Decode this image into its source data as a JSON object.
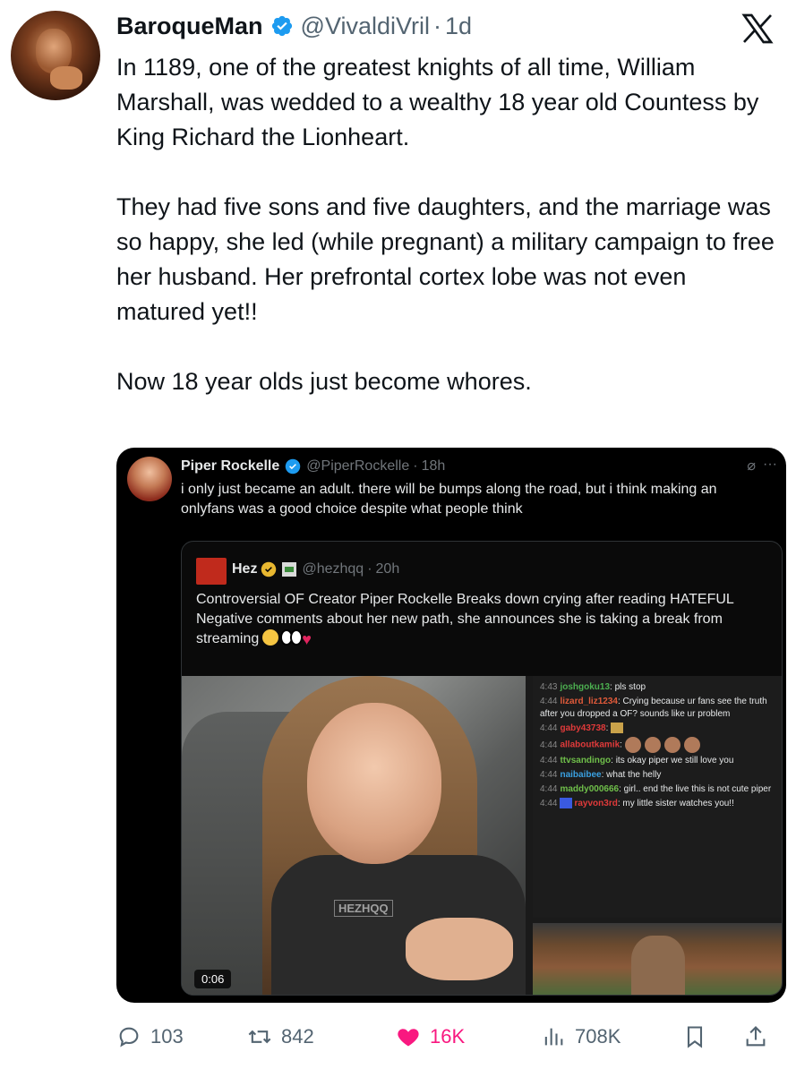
{
  "tweet": {
    "name": "BaroqueMan",
    "handle": "@VivaldiVril",
    "separator": "·",
    "time": "1d",
    "paragraphs": [
      "In 1189, one of the greatest knights of all time, William Marshall, was wedded to a wealthy 18 year old Countess by King Richard the Lionheart.",
      "They had five sons and five daughters, and the marriage was so happy, she led (while pregnant) a military campaign to free her husband. Her prefrontal cortex lobe was not even matured yet!!",
      "Now 18 year olds just become whores."
    ],
    "icons": [
      "verified-badge-icon",
      "x-logo-icon"
    ]
  },
  "quote": {
    "name": "Piper Rockelle",
    "handle": "@PiperRockelle",
    "separator": "·",
    "time": "18h",
    "text": "i only just became an adult. there will be bumps along the road, but i think making an onlyfans was a good choice despite what people think",
    "icons": [
      "edit-icon",
      "more-icon"
    ]
  },
  "inner_quote": {
    "name": "Hez",
    "handle": "@hezhqq",
    "separator": "·",
    "time": "20h",
    "text": "Controversial OF Creator Piper Rockelle Breaks down crying after reading HATEFUL Negative comments about her new path, she announces she is taking a break from streaming"
  },
  "video": {
    "duration": "0:06",
    "watermark": "HEZHQQ",
    "chat": [
      {
        "time": "4:43",
        "user": "joshgoku13",
        "user_color": "#4caf50",
        "msg": ": pls stop"
      },
      {
        "time": "4:44",
        "user": "lizard_liz1234",
        "user_color": "#e05a3a",
        "msg": ": Crying because ur fans see the truth after you dropped a OF? sounds like ur problem"
      },
      {
        "time": "4:44",
        "user": "gaby43738",
        "user_color": "#e03a3a",
        "msg": ":"
      },
      {
        "time": "4:44",
        "user": "allaboutkamik",
        "user_color": "#e03a3a",
        "msg": ":"
      },
      {
        "time": "4:44",
        "user": "ttvsandingo",
        "user_color": "#6fbf4a",
        "msg": ": its okay piper we still love you"
      },
      {
        "time": "4:44",
        "user": "naibaibee",
        "user_color": "#3aa0e0",
        "msg": ": what the helly"
      },
      {
        "time": "4:44",
        "user": "maddy000666",
        "user_color": "#6fbf4a",
        "msg": ": girl.. end the live this is not cute piper"
      },
      {
        "time": "4:44",
        "user": "rayvon3rd",
        "user_color": "#e03a3a",
        "msg": ": my little sister watches you!!"
      }
    ]
  },
  "actions": {
    "replies": "103",
    "reposts": "842",
    "likes": "16K",
    "views": "708K"
  },
  "colors": {
    "verified": "#1d9bf0",
    "like": "#f91880",
    "muted": "#536471"
  }
}
